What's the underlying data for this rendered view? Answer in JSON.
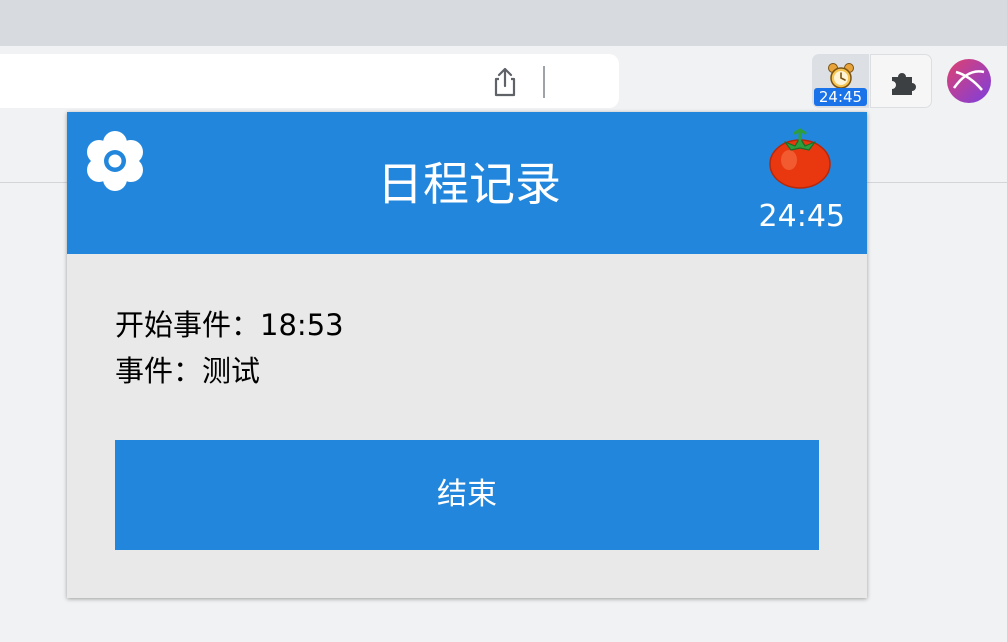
{
  "browser": {
    "extension_badge": "24:45",
    "icons": [
      "share-icon",
      "alarm-clock-icon",
      "puzzle-icon",
      "profile-avatar"
    ]
  },
  "popup": {
    "title": "日程记录",
    "timer": "24:45",
    "settings_icon": "gear-icon",
    "tomato_icon": "tomato-icon",
    "start_label": "开始事件：",
    "start_time": "18:53",
    "event_label": "事件：",
    "event_name": "测试",
    "end_button": "结束"
  },
  "colors": {
    "accent": "#2287dc",
    "popup_body": "#e9e9ea",
    "badge": "#1a73e8"
  }
}
